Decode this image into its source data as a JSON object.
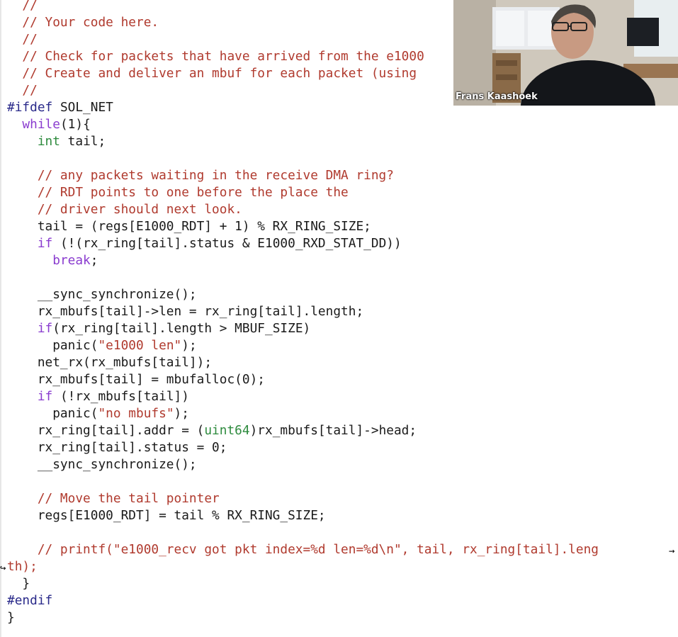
{
  "editor": {
    "lines": [
      [
        {
          "t": "  //",
          "c": "comment"
        }
      ],
      [
        {
          "t": "  // Your code here.",
          "c": "comment"
        }
      ],
      [
        {
          "t": "  //",
          "c": "comment"
        }
      ],
      [
        {
          "t": "  // Check for packets that have arrived from the e1000",
          "c": "comment"
        }
      ],
      [
        {
          "t": "  // Create and deliver an mbuf for each packet (using",
          "c": "comment"
        }
      ],
      [
        {
          "t": "  //",
          "c": "comment"
        }
      ],
      [
        {
          "t": "#ifdef",
          "c": "pre"
        },
        {
          "t": " SOL_NET",
          "c": "plain"
        }
      ],
      [
        {
          "t": "  ",
          "c": "plain"
        },
        {
          "t": "while",
          "c": "keyword"
        },
        {
          "t": "(1){",
          "c": "plain"
        }
      ],
      [
        {
          "t": "    ",
          "c": "plain"
        },
        {
          "t": "int",
          "c": "type"
        },
        {
          "t": " tail;",
          "c": "plain"
        }
      ],
      [
        {
          "t": "",
          "c": "plain"
        }
      ],
      [
        {
          "t": "    // any packets waiting in the receive DMA ring?",
          "c": "comment"
        }
      ],
      [
        {
          "t": "    // RDT points to one before the place the",
          "c": "comment"
        }
      ],
      [
        {
          "t": "    // driver should next look.",
          "c": "comment"
        }
      ],
      [
        {
          "t": "    tail = (regs[E1000_RDT] + 1) % RX_RING_SIZE;",
          "c": "plain"
        }
      ],
      [
        {
          "t": "    ",
          "c": "plain"
        },
        {
          "t": "if",
          "c": "keyword"
        },
        {
          "t": " (!(rx_ring[tail].status & E1000_RXD_STAT_DD))",
          "c": "plain"
        }
      ],
      [
        {
          "t": "      ",
          "c": "plain"
        },
        {
          "t": "break",
          "c": "keyword"
        },
        {
          "t": ";",
          "c": "plain"
        }
      ],
      [
        {
          "t": "",
          "c": "plain"
        }
      ],
      [
        {
          "t": "    __sync_synchronize();",
          "c": "plain"
        }
      ],
      [
        {
          "t": "    rx_mbufs[tail]->len = rx_ring[tail].length;",
          "c": "plain"
        }
      ],
      [
        {
          "t": "    ",
          "c": "plain"
        },
        {
          "t": "if",
          "c": "keyword"
        },
        {
          "t": "(rx_ring[tail].length > MBUF_SIZE)",
          "c": "plain"
        }
      ],
      [
        {
          "t": "      panic(",
          "c": "plain"
        },
        {
          "t": "\"e1000 len\"",
          "c": "string"
        },
        {
          "t": ");",
          "c": "plain"
        }
      ],
      [
        {
          "t": "    net_rx(rx_mbufs[tail]);",
          "c": "plain"
        }
      ],
      [
        {
          "t": "    rx_mbufs[tail] = mbufalloc(0);",
          "c": "plain"
        }
      ],
      [
        {
          "t": "    ",
          "c": "plain"
        },
        {
          "t": "if",
          "c": "keyword"
        },
        {
          "t": " (!rx_mbufs[tail])",
          "c": "plain"
        }
      ],
      [
        {
          "t": "      panic(",
          "c": "plain"
        },
        {
          "t": "\"no mbufs\"",
          "c": "string"
        },
        {
          "t": ");",
          "c": "plain"
        }
      ],
      [
        {
          "t": "    rx_ring[tail].addr = (",
          "c": "plain"
        },
        {
          "t": "uint64",
          "c": "type"
        },
        {
          "t": ")rx_mbufs[tail]->head;",
          "c": "plain"
        }
      ],
      [
        {
          "t": "    rx_ring[tail].status = 0;",
          "c": "plain"
        }
      ],
      [
        {
          "t": "    __sync_synchronize();",
          "c": "plain"
        }
      ],
      [
        {
          "t": "",
          "c": "plain"
        }
      ],
      [
        {
          "t": "    // Move the tail pointer",
          "c": "comment"
        }
      ],
      [
        {
          "t": "    regs[E1000_RDT] = tail % RX_RING_SIZE;",
          "c": "plain"
        }
      ],
      [
        {
          "t": "",
          "c": "plain"
        }
      ],
      [
        {
          "t": "    // printf(\"e1000_recv got pkt index=%d len=%d\\n\", tail, rx_ring[tail].leng",
          "c": "comment"
        }
      ],
      [
        {
          "t": "th);",
          "c": "comment"
        }
      ],
      [
        {
          "t": "  }",
          "c": "plain"
        }
      ],
      [
        {
          "t": "#endif",
          "c": "pre"
        }
      ],
      [
        {
          "t": "}",
          "c": "plain"
        }
      ]
    ],
    "wrap_marker_start": "→",
    "wrap_marker_end": "↪"
  },
  "video": {
    "participant_name": "Frans Kaashoek"
  }
}
